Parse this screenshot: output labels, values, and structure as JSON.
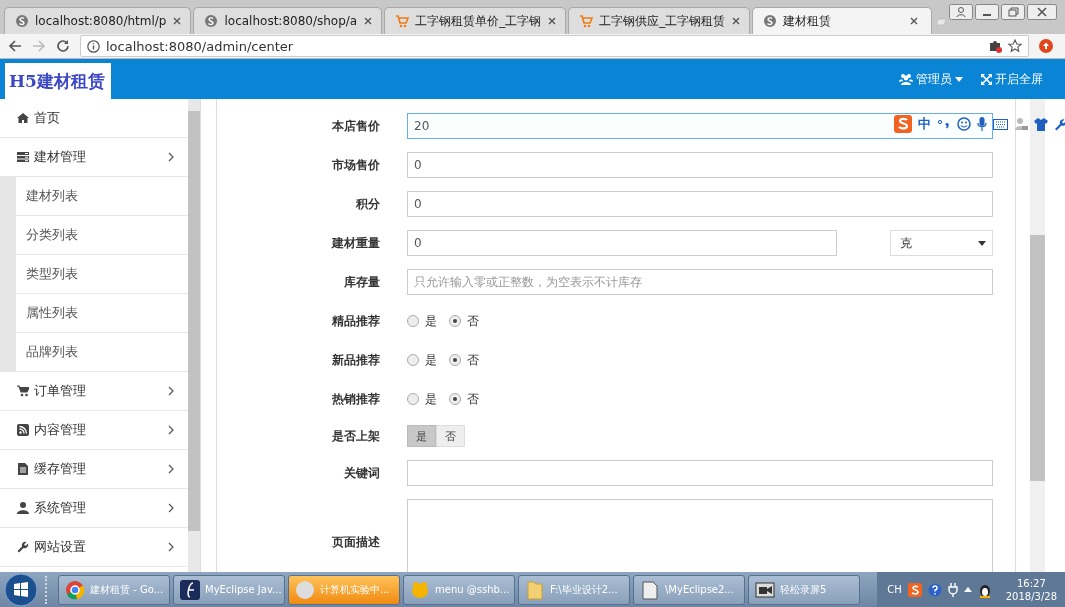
{
  "browser": {
    "tabs": [
      {
        "title": "localhost:8080/html/p",
        "kind": "site",
        "selected": false
      },
      {
        "title": "localhost:8080/shop/a",
        "kind": "site",
        "selected": false
      },
      {
        "title": "工字钢租赁单价_工字钢",
        "kind": "shop",
        "selected": false
      },
      {
        "title": "工字钢供应_工字钢租赁",
        "kind": "shop",
        "selected": false
      },
      {
        "title": "建材租赁",
        "kind": "site",
        "selected": true
      }
    ],
    "address": "localhost:8080/admin/center"
  },
  "header": {
    "logo": "H5建材租赁",
    "user_menu": "管理员",
    "fullscreen": "开启全屏"
  },
  "sidebar": {
    "items": [
      {
        "label": "首页",
        "kind": "link"
      },
      {
        "label": "建材管理",
        "kind": "group",
        "expanded": true,
        "children": [
          {
            "label": "建材列表"
          },
          {
            "label": "分类列表"
          },
          {
            "label": "类型列表"
          },
          {
            "label": "属性列表"
          },
          {
            "label": "品牌列表"
          }
        ]
      },
      {
        "label": "订单管理",
        "kind": "group"
      },
      {
        "label": "内容管理",
        "kind": "group"
      },
      {
        "label": "缓存管理",
        "kind": "group"
      },
      {
        "label": "系统管理",
        "kind": "group"
      },
      {
        "label": "网站设置",
        "kind": "group"
      }
    ]
  },
  "form": {
    "rows": [
      {
        "kind": "input",
        "label": "本店售价",
        "value": "20",
        "focused": true
      },
      {
        "kind": "input",
        "label": "市场售价",
        "value": "0",
        "focused": false
      },
      {
        "kind": "input",
        "label": "积分",
        "value": "0",
        "focused": false
      },
      {
        "kind": "input_select",
        "label": "建材重量",
        "value": "0",
        "unit": "克"
      },
      {
        "kind": "input",
        "label": "库存量",
        "placeholder": "只允许输入零或正整数，为空表示不计库存",
        "focused": false
      },
      {
        "kind": "radio",
        "label": "精品推荐",
        "options": [
          {
            "label": "是",
            "selected": false
          },
          {
            "label": "否",
            "selected": true
          }
        ]
      },
      {
        "kind": "radio",
        "label": "新品推荐",
        "options": [
          {
            "label": "是",
            "selected": false
          },
          {
            "label": "否",
            "selected": true
          }
        ]
      },
      {
        "kind": "radio",
        "label": "热销推荐",
        "options": [
          {
            "label": "是",
            "selected": false
          },
          {
            "label": "否",
            "selected": true
          }
        ]
      },
      {
        "kind": "toggle",
        "label": "是否上架",
        "options": [
          {
            "label": "是",
            "selected": true
          },
          {
            "label": "否",
            "selected": false
          }
        ]
      },
      {
        "kind": "input",
        "label": "关键词",
        "focused": false
      },
      {
        "kind": "textarea",
        "label": "页面描述"
      }
    ]
  },
  "ime_toolbar": {
    "mode": "中"
  },
  "taskbar": {
    "tasks": [
      {
        "label": "建材租赁 - Go...",
        "highlighted": false
      },
      {
        "label": "MyEclipse Jav...",
        "highlighted": false
      },
      {
        "label": "计算机实验中...",
        "highlighted": true
      },
      {
        "label": "menu @sshb...",
        "highlighted": false
      },
      {
        "label": "F:\\毕业设计2...",
        "highlighted": false
      },
      {
        "label": "\\MyEclipse2...",
        "highlighted": false
      },
      {
        "label": "轻松录屏5",
        "highlighted": false
      }
    ],
    "tray": {
      "language": "CH",
      "time": "16:27",
      "date": "2018/3/28"
    }
  }
}
